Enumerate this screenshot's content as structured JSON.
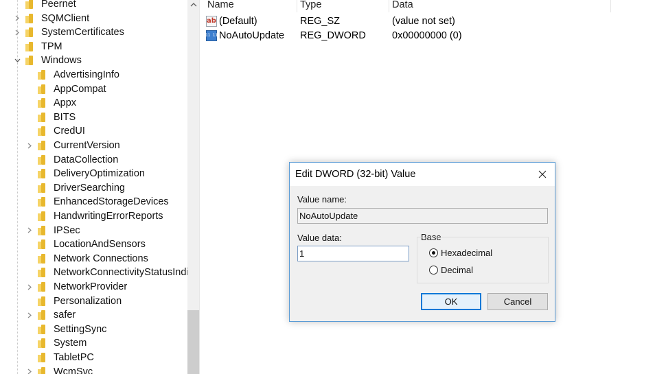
{
  "tree": {
    "items": [
      {
        "label": "Peernet",
        "expander": "",
        "level": 1
      },
      {
        "label": "SQMClient",
        "expander": ">",
        "level": 1
      },
      {
        "label": "SystemCertificates",
        "expander": ">",
        "level": 1
      },
      {
        "label": "TPM",
        "expander": "",
        "level": 1
      },
      {
        "label": "Windows",
        "expander": "v",
        "level": 1
      },
      {
        "label": "AdvertisingInfo",
        "expander": "",
        "level": 2
      },
      {
        "label": "AppCompat",
        "expander": "",
        "level": 2
      },
      {
        "label": "Appx",
        "expander": "",
        "level": 2
      },
      {
        "label": "BITS",
        "expander": "",
        "level": 2
      },
      {
        "label": "CredUI",
        "expander": "",
        "level": 2
      },
      {
        "label": "CurrentVersion",
        "expander": ">",
        "level": 2
      },
      {
        "label": "DataCollection",
        "expander": "",
        "level": 2
      },
      {
        "label": "DeliveryOptimization",
        "expander": "",
        "level": 2
      },
      {
        "label": "DriverSearching",
        "expander": "",
        "level": 2
      },
      {
        "label": "EnhancedStorageDevices",
        "expander": "",
        "level": 2
      },
      {
        "label": "HandwritingErrorReports",
        "expander": "",
        "level": 2
      },
      {
        "label": "IPSec",
        "expander": ">",
        "level": 2
      },
      {
        "label": "LocationAndSensors",
        "expander": "",
        "level": 2
      },
      {
        "label": "Network Connections",
        "expander": "",
        "level": 2
      },
      {
        "label": "NetworkConnectivityStatusIndicat",
        "expander": "",
        "level": 2
      },
      {
        "label": "NetworkProvider",
        "expander": ">",
        "level": 2
      },
      {
        "label": "Personalization",
        "expander": "",
        "level": 2
      },
      {
        "label": "safer",
        "expander": ">",
        "level": 2
      },
      {
        "label": "SettingSync",
        "expander": "",
        "level": 2
      },
      {
        "label": "System",
        "expander": "",
        "level": 2
      },
      {
        "label": "TabletPC",
        "expander": "",
        "level": 2
      },
      {
        "label": "WcmSvc",
        "expander": ">",
        "level": 2
      }
    ]
  },
  "list": {
    "columns": {
      "name": "Name",
      "type": "Type",
      "data": "Data"
    },
    "rows": [
      {
        "icon": "string-value-icon",
        "icon_text": "ab",
        "name": "(Default)",
        "type": "REG_SZ",
        "data": "(value not set)"
      },
      {
        "icon": "binary-value-icon",
        "icon_text": "011 110",
        "name": "NoAutoUpdate",
        "type": "REG_DWORD",
        "data": "0x00000000 (0)"
      }
    ]
  },
  "dialog": {
    "title": "Edit DWORD (32-bit) Value",
    "value_name_label": "Value name:",
    "value_name": "NoAutoUpdate",
    "value_data_label": "Value data:",
    "value_data": "1",
    "base_label": "Base",
    "base_options": [
      {
        "label": "Hexadecimal",
        "checked": true
      },
      {
        "label": "Decimal",
        "checked": false
      }
    ],
    "ok_label": "OK",
    "cancel_label": "Cancel"
  }
}
